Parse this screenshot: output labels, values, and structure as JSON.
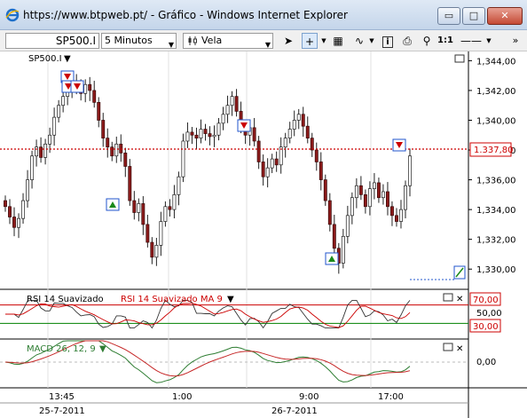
{
  "window": {
    "title": "https://www.btpweb.pt/ - Gráfico - Windows Internet Explorer",
    "min_glyph": "▭",
    "max_glyph": "□",
    "close_glyph": "✕"
  },
  "toolbar": {
    "symbol": "SP500.I",
    "interval": "5 Minutos",
    "chart_style": "Vela",
    "zoom_reset": "1:1"
  },
  "chart": {
    "symbol_label": "SP500.I",
    "price_axis": [
      "1,344,00",
      "1,342,00",
      "1,340,00",
      "1,338,00",
      "1,336,00",
      "1,334,00",
      "1,332,00",
      "1,330,00"
    ],
    "last_price": "1.337,80",
    "time_axis": [
      "13:45",
      "1:00",
      "9:00",
      "17:00"
    ],
    "date_axis": [
      "25-7-2011",
      "26-7-2011"
    ],
    "rsi_label": "RSI 14 Suavizado",
    "rsi_ma_label": "RSI 14 Suavizado MA 9",
    "rsi_axis": [
      "70,00",
      "50,00",
      "30,00"
    ],
    "macd_label": "MACD 26, 12, 9",
    "macd_axis": "0,00",
    "colors": {
      "bull": "#1f1f1f",
      "bear": "#8b1a1a",
      "rsi_level": "#cc0000",
      "rsi_low": "#008000",
      "macd_green": "#2e7d32",
      "macd_red": "#c62828",
      "last_price_line": "#cc0000"
    }
  },
  "chart_data": {
    "type": "candlestick",
    "price_ylim": [
      1329.0,
      1344.5
    ],
    "close_series": [
      1334.2,
      1333.5,
      1332.8,
      1333.4,
      1334.6,
      1336.0,
      1337.6,
      1338.2,
      1337.5,
      1338.4,
      1339.0,
      1340.2,
      1341.0,
      1341.6,
      1342.2,
      1342.6,
      1342.1,
      1341.8,
      1342.4,
      1342.0,
      1341.2,
      1340.0,
      1338.8,
      1338.2,
      1337.6,
      1338.4,
      1337.8,
      1336.9,
      1334.6,
      1333.8,
      1334.4,
      1333.0,
      1331.8,
      1330.8,
      1331.6,
      1333.2,
      1334.2,
      1334.0,
      1335.0,
      1336.2,
      1338.6,
      1339.2,
      1339.0,
      1338.8,
      1339.4,
      1339.1,
      1338.9,
      1339.0,
      1339.8,
      1340.4,
      1341.0,
      1341.6,
      1340.6,
      1339.6,
      1339.0,
      1339.5,
      1338.6,
      1337.2,
      1336.2,
      1336.8,
      1337.4,
      1337.0,
      1338.2,
      1338.8,
      1339.4,
      1340.0,
      1340.4,
      1339.6,
      1338.8,
      1338.0,
      1337.2,
      1336.0,
      1334.6,
      1333.0,
      1331.4,
      1330.4,
      1332.2,
      1333.6,
      1334.8,
      1335.6,
      1335.0,
      1334.2,
      1335.4,
      1335.8,
      1334.8,
      1335.2,
      1334.2,
      1333.6,
      1333.2,
      1334.0,
      1335.6,
      1337.6
    ]
  }
}
